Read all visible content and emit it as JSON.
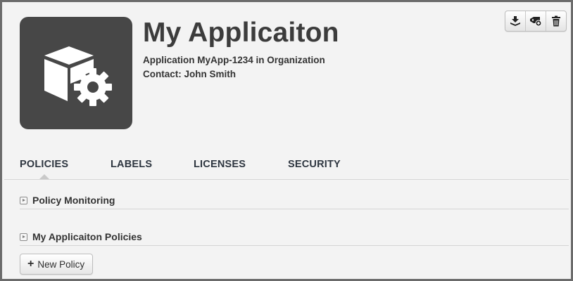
{
  "header": {
    "title": "My Applicaiton",
    "subtitle": "Application MyApp-1234 in Organization",
    "contact": "Contact: John Smith",
    "icon": "cube-gear-icon"
  },
  "toolbar": {
    "buttons": [
      {
        "icon": "download-stack-icon"
      },
      {
        "icon": "tag-add-icon"
      },
      {
        "icon": "trash-icon"
      }
    ]
  },
  "tabs": [
    {
      "label": "POLICIES",
      "active": true
    },
    {
      "label": "LABELS"
    },
    {
      "label": "LICENSES"
    },
    {
      "label": "SECURITY"
    }
  ],
  "sections": [
    {
      "title": "Policy Monitoring",
      "icon": "expand-toggle-icon"
    },
    {
      "title": "My Applicaiton Policies",
      "icon": "expand-toggle-icon"
    }
  ],
  "actions": {
    "new_policy_label": "New Policy",
    "new_policy_icon": "plus-icon"
  },
  "colors": {
    "icon_tile": "#474747",
    "background": "#f3f3f3",
    "text": "#333333"
  }
}
